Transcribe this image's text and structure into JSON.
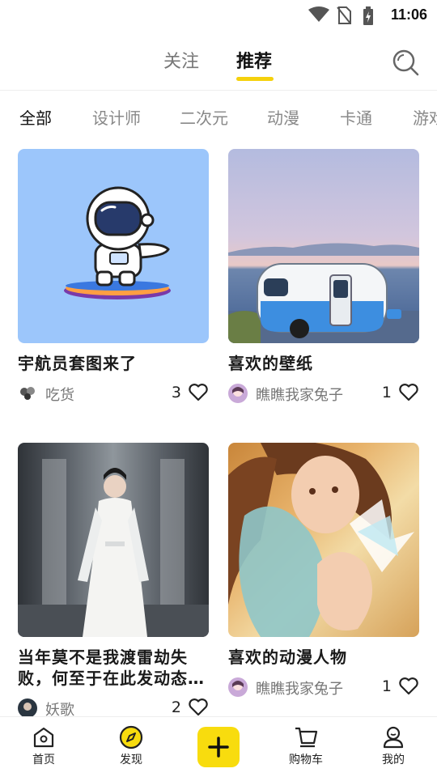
{
  "status_bar": {
    "time": "11:06"
  },
  "header": {
    "tabs": [
      {
        "label": "关注"
      },
      {
        "label": "推荐"
      }
    ],
    "active_tab": "推荐"
  },
  "categories": [
    {
      "label": "全部"
    },
    {
      "label": "设计师"
    },
    {
      "label": "二次元"
    },
    {
      "label": "动漫"
    },
    {
      "label": "卡通"
    },
    {
      "label": "游戏"
    }
  ],
  "feed": [
    {
      "title": "宇航员套图来了",
      "author": "吃货",
      "likes": "3",
      "thumb": "astronaut-illustration"
    },
    {
      "title": "喜欢的壁纸",
      "author": "瞧瞧我家兔子",
      "likes": "1",
      "thumb": "caravan-seaside-photo"
    },
    {
      "title": "当年莫不是我渡雷劫失败，何至于在此发动态…",
      "author": "妖歌",
      "likes": "2",
      "thumb": "white-robed-man-photo"
    },
    {
      "title": "喜欢的动漫人物",
      "author": "瞧瞧我家兔子",
      "likes": "1",
      "thumb": "anime-girl-painting"
    }
  ],
  "bottom_nav": {
    "items": [
      {
        "label": "首页"
      },
      {
        "label": "发现"
      },
      {
        "label": "购物车"
      },
      {
        "label": "我的"
      }
    ],
    "accent": "#F8DC0E"
  }
}
